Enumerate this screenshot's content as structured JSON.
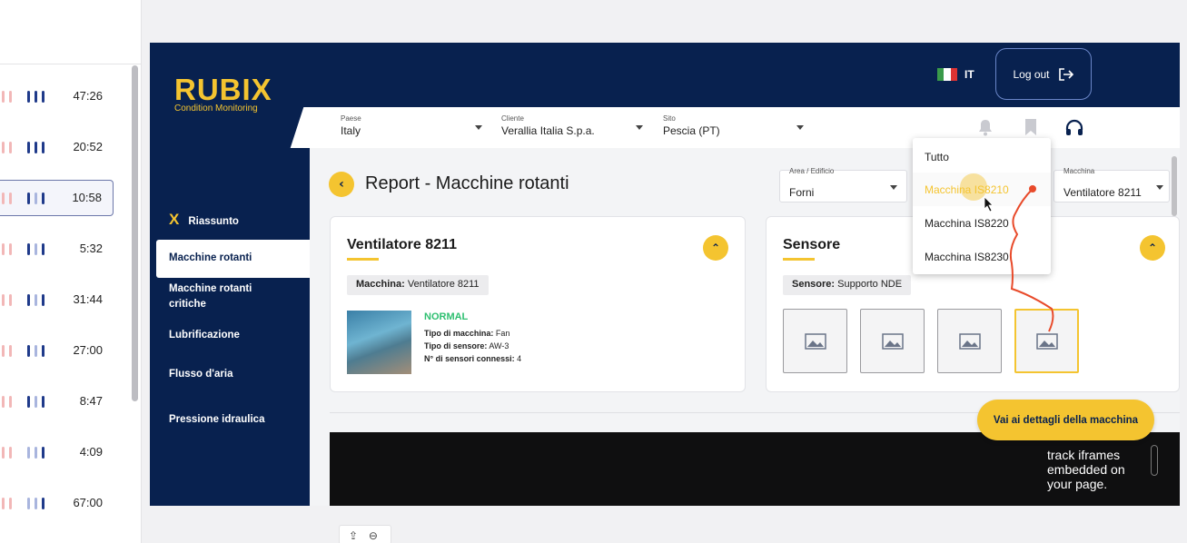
{
  "sessions": [
    {
      "time": "47:26"
    },
    {
      "time": "20:52"
    },
    {
      "time": "10:58",
      "selected": true
    },
    {
      "time": "5:32"
    },
    {
      "time": "31:44"
    },
    {
      "time": "27:00"
    },
    {
      "time": "8:47"
    },
    {
      "time": "4:09"
    },
    {
      "time": "67:00"
    }
  ],
  "brand": {
    "name": "RUBIX",
    "subtitle": "Condition Monitoring",
    "accent": "#f4c430",
    "navy": "#08214f"
  },
  "header": {
    "lang_code": "IT",
    "logout_label": "Log out"
  },
  "filters": {
    "country": {
      "label": "Paese",
      "value": "Italy"
    },
    "client": {
      "label": "Cliente",
      "value": "Verallia Italia S.p.a."
    },
    "site": {
      "label": "Sito",
      "value": "Pescia (PT)"
    }
  },
  "sidebar": {
    "items": [
      {
        "label": "Riassunto"
      },
      {
        "label": "Macchine rotanti"
      },
      {
        "label": "Macchine rotanti critiche"
      },
      {
        "label": "Lubrificazione"
      },
      {
        "label": "Flusso d'aria"
      },
      {
        "label": "Pressione idraulica"
      }
    ]
  },
  "page": {
    "title": "Report - Macchine rotanti",
    "area": {
      "label": "Area / Edificio",
      "value": "Forni"
    },
    "machine": {
      "label": "Macchina",
      "value": "Ventilatore 8211"
    }
  },
  "machine_card": {
    "title": "Ventilatore 8211",
    "tag_label": "Macchina:",
    "tag_value": "Ventilatore 8211",
    "status": "NORMAL",
    "type_label": "Tipo di macchina:",
    "type_value": "Fan",
    "sensor_type_label": "Tipo di sensore:",
    "sensor_type_value": "AW-3",
    "sensors_label": "N° di sensori connessi:",
    "sensors_value": "4"
  },
  "sensor_card": {
    "title": "Sensore",
    "tag_label": "Sensore:",
    "tag_value": "Supporto NDE"
  },
  "dropdown_menu": {
    "items": [
      "Tutto",
      "Macchina IS8210",
      "Macchina IS8220",
      "Macchina IS8230"
    ]
  },
  "cta": {
    "label": "Vai ai dettagli della macchina"
  },
  "video": {
    "line1": "track iframes",
    "line2": "embedded on",
    "line3": "your page."
  }
}
